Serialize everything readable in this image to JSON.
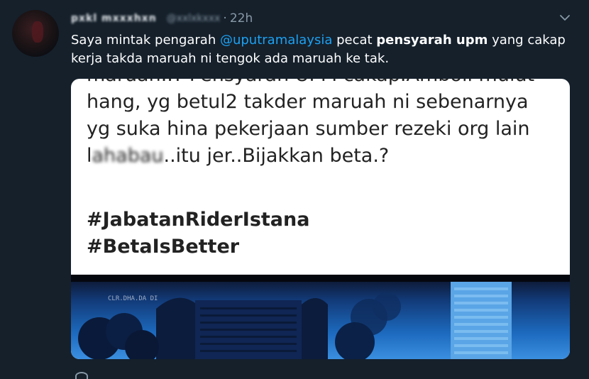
{
  "tweet": {
    "display_name": "pxkl mxxxhxn",
    "handle": "@xxlxkxxx",
    "separator": " · ",
    "time": "22h",
    "text": {
      "part1": "Saya mintak pengarah ",
      "mention": "@uputramalaysia",
      "part2": " pecat ",
      "bold": "pensyarah upm",
      "part3": " yang cakap kerja takda maruah ni tengok ada maruah ke tak."
    }
  },
  "media": {
    "lines": [
      "maruah..? Pensyarah UPM cakap.Amboii mulut",
      "hang, yg betul2 takder maruah ni sebenarnya",
      "yg suka hina pekerjaan sumber rezeki org lain"
    ],
    "line4_start": "l",
    "line4_blurred": "ahabau",
    "line4_end": "..itu jer..Bijakkan beta.?",
    "hashtags": [
      "#JabatanRiderIstana",
      "#BetaIsBetter"
    ],
    "photo_caption": "CLR.DHA.DA DI"
  },
  "colors": {
    "background": "#15202b",
    "mention": "#1da1f2",
    "muted": "#8899a6"
  },
  "icons": {
    "caret": "chevron-down-icon",
    "reply": "reply-icon"
  }
}
